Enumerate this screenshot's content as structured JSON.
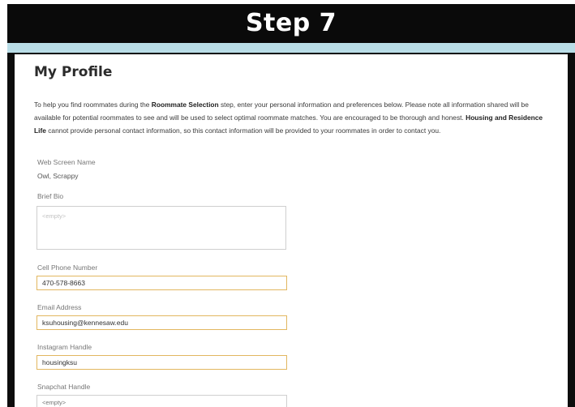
{
  "banner": {
    "title": "Step 7"
  },
  "page": {
    "title": "My Profile",
    "intro_before": "To help you find roommates during the ",
    "intro_strong1": "Roommate Selection",
    "intro_middle": " step, enter your personal information and preferences below. Please note all information shared will be available for potential roommates to see and will be used to select optimal roommate matches. You are encouraged to be thorough and honest. ",
    "intro_strong2": "Housing and Residence Life",
    "intro_after": " cannot provide personal contact information, so this contact information will be provided to your roommates in order to contact you."
  },
  "fields": {
    "screen_name": {
      "label": "Web Screen Name",
      "value": "Owl, Scrappy"
    },
    "bio": {
      "label": "Brief Bio",
      "placeholder": "<empty>"
    },
    "phone": {
      "label": "Cell Phone Number",
      "value": "470-578-8663"
    },
    "email": {
      "label": "Email Address",
      "value": "ksuhousing@kennesaw.edu"
    },
    "instagram": {
      "label": "Instagram Handle",
      "value": "housingksu"
    },
    "snapchat": {
      "label": "Snapchat Handle",
      "placeholder": "<empty>"
    }
  },
  "colors": {
    "banner_bg": "#0a0a0a",
    "accent_bar": "#b9dde7",
    "input_border_active": "#e2b760"
  }
}
